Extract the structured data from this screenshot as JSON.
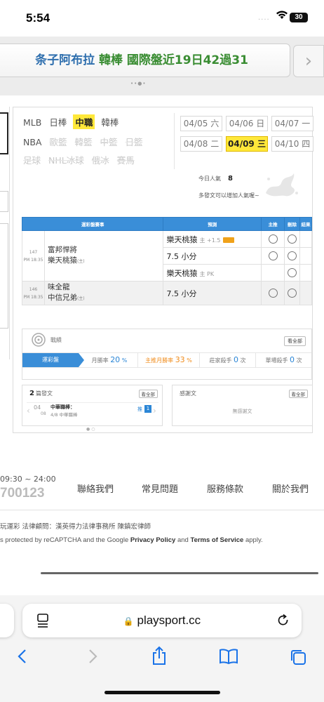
{
  "status_bar": {
    "time": "5:54",
    "signal": "....",
    "battery": "30"
  },
  "banner": {
    "text_blue": "条子阿布拉",
    "text_green": "韓棒 國際盤近19日42過31",
    "arrow": "›",
    "dots": "••●•"
  },
  "sports": {
    "row1": [
      {
        "label": "MLB",
        "state": "normal"
      },
      {
        "label": "日棒",
        "state": "normal"
      },
      {
        "label": "中職",
        "state": "selected"
      },
      {
        "label": "韓棒",
        "state": "normal"
      }
    ],
    "row2": [
      {
        "label": "NBA",
        "state": "normal"
      },
      {
        "label": "歐籃",
        "state": "dim"
      },
      {
        "label": "韓籃",
        "state": "dim"
      },
      {
        "label": "中籃",
        "state": "dim"
      },
      {
        "label": "日籃",
        "state": "dim"
      }
    ],
    "row3": [
      {
        "label": "足球",
        "state": "dim"
      },
      {
        "label": "NHL冰球",
        "state": "dim"
      },
      {
        "label": "俄冰",
        "state": "dim"
      },
      {
        "label": "賽馬",
        "state": "dim"
      }
    ]
  },
  "dates": [
    {
      "date": "04/05",
      "day": "六",
      "selected": false
    },
    {
      "date": "04/06",
      "day": "日",
      "selected": false
    },
    {
      "date": "04/07",
      "day": "一",
      "selected": false
    },
    {
      "date": "04/08",
      "day": "二",
      "selected": false
    },
    {
      "date": "04/09",
      "day": "三",
      "selected": true
    },
    {
      "date": "04/10",
      "day": "四",
      "selected": false
    }
  ],
  "popularity": {
    "label": "今日人氣",
    "value": "8",
    "note": "多發文可以增加人氣喔~"
  },
  "table": {
    "headers": [
      "運彩盤賽事",
      "預測",
      "主推",
      "刪除",
      "結果"
    ],
    "games": [
      {
        "no": "147",
        "time": "PM 18:35",
        "away": "富邦悍將",
        "home": "樂天桃猿",
        "home_tag": "(主)"
      },
      {
        "no": "146",
        "time": "PM 18:35",
        "away": "味全龍",
        "home": "中信兄弟",
        "home_tag": "(主)"
      }
    ],
    "picks": [
      {
        "team": "樂天桃猿",
        "detail": "主 +1.5"
      },
      {
        "team": "7.5 小分",
        "detail": ""
      },
      {
        "team": "樂天桃猿",
        "detail": "主 PK"
      },
      {
        "team": "7.5 小分",
        "detail": ""
      }
    ]
  },
  "record": {
    "title": "戰績",
    "view_all": "看全部",
    "tab": "運彩盤",
    "stats": [
      {
        "label": "月勝率",
        "value": "20",
        "unit": "%",
        "color": "#2b86d6"
      },
      {
        "label": "主推月勝率",
        "value": "33",
        "unit": "%",
        "color": "#f08c1c"
      },
      {
        "label": "莊家殺手",
        "value": "0",
        "unit": "次",
        "color": "#2b86d6"
      },
      {
        "label": "單場殺手",
        "value": "0",
        "unit": "次",
        "color": "#2b86d6"
      }
    ]
  },
  "posts": {
    "count": "2",
    "label": "篇發文",
    "view_all": "看全部",
    "item_month": "04",
    "item_day": "08",
    "item_title": "中華職棒：",
    "item_sub": "4/8 中華職棒",
    "tag": "推",
    "tag_num": "1"
  },
  "thanks": {
    "label": "感謝文",
    "view_all": "看全部",
    "empty": "無感謝文"
  },
  "footer": {
    "hours": "09:30 ~ 24:00",
    "phone": "700123",
    "links": [
      "聯絡我們",
      "常見問題",
      "服務條款",
      "關於我們"
    ],
    "legal": "玩運彩 法律顧問：漢英得力法律事務所 陳鎮宏律師",
    "captcha_pre": "s protected by reCAPTCHA and the Google ",
    "privacy": "Privacy Policy",
    "and": " and ",
    "terms": "Terms of Service",
    "captcha_post": " apply."
  },
  "browser": {
    "url": "playsport.cc"
  }
}
